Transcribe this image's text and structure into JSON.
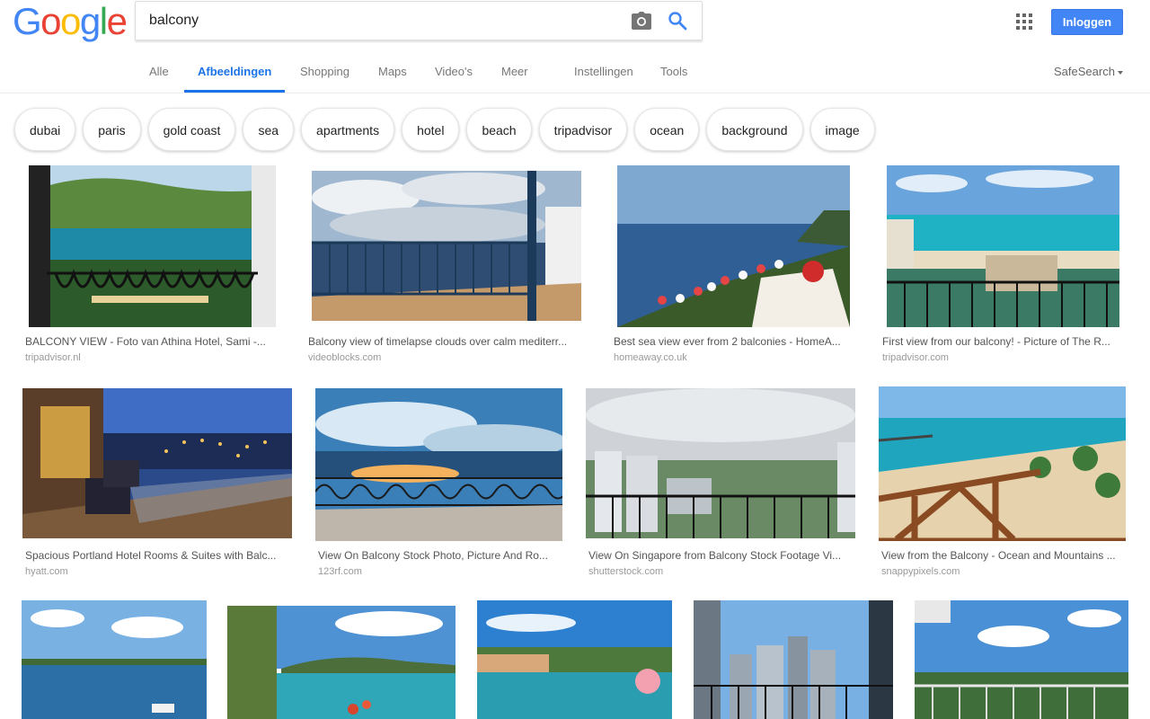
{
  "logo": {
    "text": "Google",
    "letters": [
      "G",
      "o",
      "o",
      "g",
      "l",
      "e"
    ],
    "colors": [
      "#4285f4",
      "#ea4335",
      "#fbbc05",
      "#4285f4",
      "#34a853",
      "#ea4335"
    ]
  },
  "search": {
    "value": "balcony",
    "camera_icon": "camera-icon",
    "search_icon": "magnifier-icon"
  },
  "header": {
    "apps_icon": "apps-grid-icon",
    "login_label": "Inloggen"
  },
  "tabs": [
    {
      "label": "Alle"
    },
    {
      "label": "Afbeeldingen",
      "active": true
    },
    {
      "label": "Shopping"
    },
    {
      "label": "Maps"
    },
    {
      "label": "Video's"
    },
    {
      "label": "Meer"
    },
    {
      "label": "Instellingen"
    },
    {
      "label": "Tools"
    }
  ],
  "safesearch": {
    "label": "SafeSearch"
  },
  "chips": [
    "dubai",
    "paris",
    "gold coast",
    "sea",
    "apartments",
    "hotel",
    "beach",
    "tripadvisor",
    "ocean",
    "background",
    "image"
  ],
  "results": [
    {
      "title": "BALCONY VIEW - Foto van Athina Hotel, Sami -...",
      "source": "tripadvisor.nl"
    },
    {
      "title": "Balcony view of timelapse clouds over calm mediterr...",
      "source": "videoblocks.com"
    },
    {
      "title": "Best sea view ever from 2 balconies - HomeA...",
      "source": "homeaway.co.uk"
    },
    {
      "title": "First view from our balcony! - Picture of The R...",
      "source": "tripadvisor.com"
    },
    {
      "title": "Spacious Portland Hotel Rooms & Suites with Balc...",
      "source": "hyatt.com"
    },
    {
      "title": "View On Balcony Stock Photo, Picture And Ro...",
      "source": "123rf.com"
    },
    {
      "title": "View On Singapore from Balcony Stock Footage Vi...",
      "source": "shutterstock.com"
    },
    {
      "title": "View from the Balcony - Ocean and Mountains ...",
      "source": "snappypixels.com"
    },
    {
      "title": "",
      "source": ""
    },
    {
      "title": "",
      "source": ""
    },
    {
      "title": "",
      "source": ""
    },
    {
      "title": "",
      "source": ""
    },
    {
      "title": "",
      "source": ""
    }
  ],
  "colors": {
    "accent": "#1a73e8",
    "login_bg": "#4285f4"
  }
}
